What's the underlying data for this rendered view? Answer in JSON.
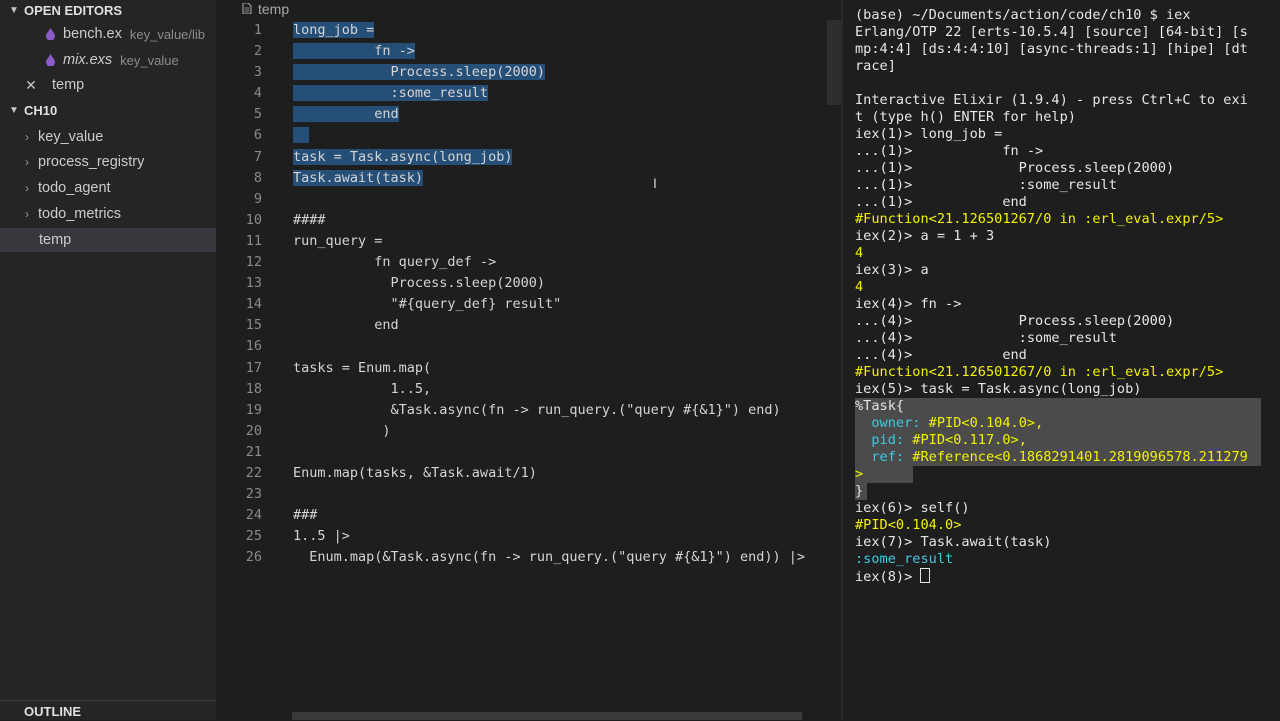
{
  "sidebar": {
    "open_editors_title": "OPEN EDITORS",
    "open_editors": [
      {
        "name": "bench.ex",
        "desc": "key_value/lib",
        "italic": false
      },
      {
        "name": "mix.exs",
        "desc": "key_value",
        "italic": true
      },
      {
        "name": "temp",
        "desc": "",
        "italic": false
      }
    ],
    "folder_title": "CH10",
    "folders": [
      "key_value",
      "process_registry",
      "todo_agent",
      "todo_metrics"
    ],
    "selected_file": "temp",
    "outline_title": "OUTLINE"
  },
  "editor": {
    "breadcrumb": "temp",
    "lines": [
      "long_job =",
      "          fn ->",
      "            Process.sleep(2000)",
      "            :some_result",
      "          end",
      "",
      "task = Task.async(long_job)",
      "Task.await(task)",
      "",
      "####",
      "run_query =",
      "          fn query_def ->",
      "            Process.sleep(2000)",
      "            \"#{query_def} result\"",
      "          end",
      "",
      "tasks = Enum.map(",
      "            1..5,",
      "            &Task.async(fn -> run_query.(\"query #{&1}\") end)",
      "           )",
      "",
      "Enum.map(tasks, &Task.await/1)",
      "",
      "###",
      "1..5 |>",
      "  Enum.map(&Task.async(fn -> run_query.(\"query #{&1}\") end)) |>"
    ]
  },
  "terminal": {
    "lines": [
      "(base) ~/Documents/action/code/ch10 $ iex",
      "Erlang/OTP 22 [erts-10.5.4] [source] [64-bit] [s",
      "mp:4:4] [ds:4:4:10] [async-threads:1] [hipe] [dt",
      "race]",
      "",
      "Interactive Elixir (1.9.4) - press Ctrl+C to exi",
      "t (type h() ENTER for help)",
      "iex(1)> long_job =",
      "...(1)>           fn ->",
      "...(1)>             Process.sleep(2000)",
      "...(1)>             :some_result",
      "...(1)>           end",
      "#Function<21.126501267/0 in :erl_eval.expr/5>",
      "iex(2)> a = 1 + 3",
      "4",
      "iex(3)> a",
      "4",
      "iex(4)> fn ->",
      "...(4)>             Process.sleep(2000)",
      "...(4)>             :some_result",
      "...(4)>           end",
      "#Function<21.126501267/0 in :erl_eval.expr/5>",
      "iex(5)> task = Task.async(long_job)",
      "%Task{",
      "  owner: ",
      "#PID<0.104.0>,",
      "  pid: ",
      "#PID<0.117.0>,",
      "  ref: ",
      "#Reference<0.1868291401.2819096578.211279",
      ">",
      "}",
      "iex(6)> self()",
      "#PID<0.104.0>",
      "iex(7)> Task.await(task)",
      ":some_result",
      "iex(8)> "
    ]
  },
  "colors": {
    "background": "#1e1e1e",
    "sidebar": "#252526",
    "selection": "#264f78",
    "terminal_yellow": "#f2f200",
    "terminal_cyan": "#41c7e3",
    "elixir_icon": "#8a5cc8"
  },
  "icons": {
    "open_editors_chevron": "chevron-down-icon",
    "file_icon": "elixir-drop-icon",
    "close": "close-icon",
    "folder_chevron": "chevron-right-icon"
  }
}
